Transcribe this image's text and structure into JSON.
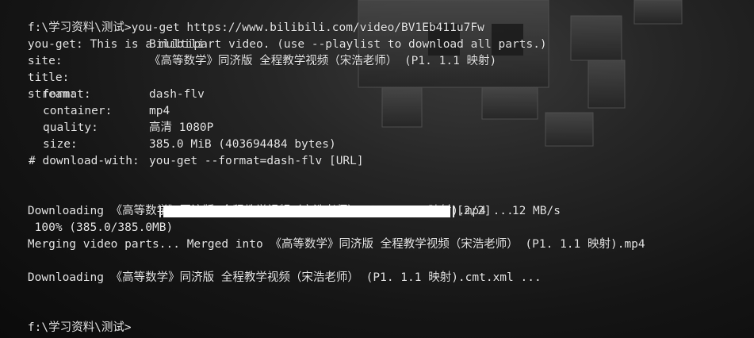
{
  "terminal": {
    "prompt": "f:\\学习资料\\测试>",
    "command": "you-get https://www.bilibili.com/video/BV1Eb411u7Fw",
    "notice": "you-get: This is a multipart video. (use --playlist to download all parts.)",
    "site_key": "site:",
    "site_value": "Bilibili",
    "title_key": "title:",
    "title_value": "《高等数学》同济版 全程教学视频（宋浩老师） (P1. 1.1 映射)",
    "stream_key": "stream:",
    "format_key": "- format:",
    "format_value": "dash-flv",
    "container_key": "container:",
    "container_value": "mp4",
    "quality_key": "quality:",
    "quality_value": "高清 1080P",
    "size_key": "size:",
    "size_value": "385.0 MiB (403694484 bytes)",
    "download_with_key": "# download-with:",
    "download_with_value": "you-get --format=dash-flv [URL]",
    "downloading_video": "Downloading 《高等数学》同济版 全程教学视频（宋浩老师） (P1. 1.1 映射).mp4 ...",
    "progress_prefix": " 100% (385.0/385.0MB)",
    "progress_fraction": 1.0,
    "progress_parts": "[2/2]",
    "progress_speed": "12 MB/s",
    "merging": "Merging video parts... Merged into 《高等数学》同济版 全程教学视频（宋浩老师） (P1. 1.1 映射).mp4",
    "downloading_cmt": "Downloading 《高等数学》同济版 全程教学视频（宋浩老师） (P1. 1.1 映射).cmt.xml ...",
    "final_prompt": "f:\\学习资料\\测试>"
  },
  "colors": {
    "text": "#e6e6e6",
    "bar_fill": "#ffffff",
    "background": "#1a1a1a"
  }
}
